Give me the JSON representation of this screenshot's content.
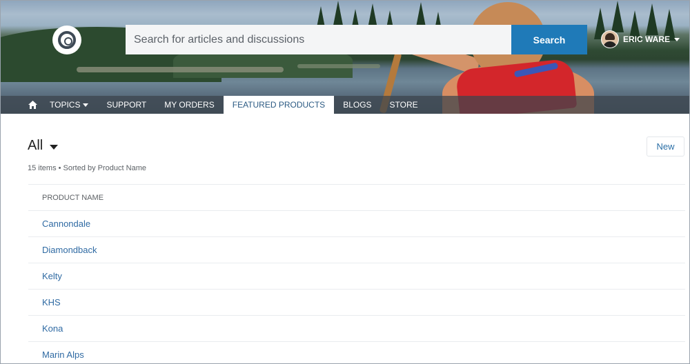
{
  "header": {
    "search": {
      "placeholder": "Search for articles and discussions",
      "button_label": "Search"
    },
    "user": {
      "name": "ERIC WARE"
    },
    "logo_icon": "community-logo-icon"
  },
  "nav": {
    "home_icon": "home-icon",
    "items": [
      {
        "label": "TOPICS",
        "has_dropdown": true
      },
      {
        "label": "SUPPORT"
      },
      {
        "label": "MY ORDERS"
      },
      {
        "label": "FEATURED PRODUCTS",
        "active": true
      },
      {
        "label": "BLOGS"
      },
      {
        "label": "STORE"
      }
    ]
  },
  "list": {
    "title": "All",
    "meta": "15 items • Sorted by Product Name",
    "new_button": "New",
    "column_header": "PRODUCT NAME",
    "rows": [
      "Cannondale",
      "Diamondback",
      "Kelty",
      "KHS",
      "Kona",
      "Marin Alps"
    ]
  },
  "colors": {
    "accent": "#1f7ab8",
    "link": "#2f6aa3"
  }
}
